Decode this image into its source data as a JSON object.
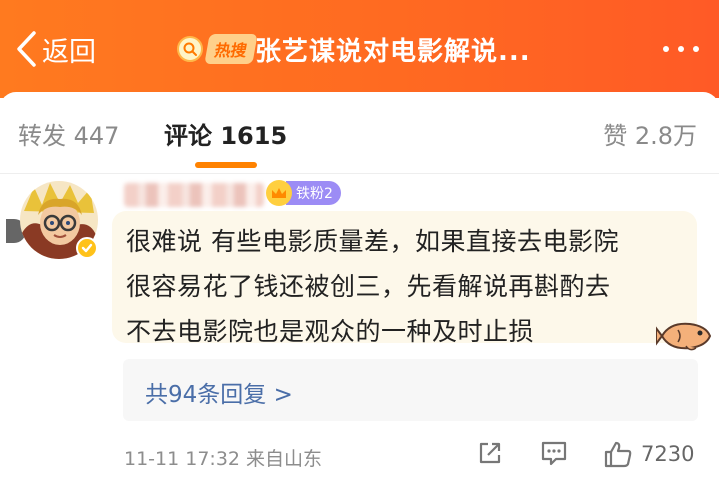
{
  "header": {
    "back_label": "返回",
    "hot_label": "热搜",
    "title": "张艺谋说对电影解说..."
  },
  "tabs": {
    "repost": "转发 447",
    "comment": "评论 1615",
    "like": "赞 2.8万",
    "active": "comment"
  },
  "comment": {
    "fan_badge": "铁粉2",
    "lines": [
      "很难说 有些电影质量差，如果直接去电影院",
      "很容易花了钱还被创三，先看解说再斟酌去",
      "不去电影院也是观众的一种及时止损"
    ],
    "replies_label": "共94条回复 >",
    "meta": "11-11 17:32  来自山东",
    "like_count": "7230"
  },
  "colors": {
    "header_orange": "#ff6a21",
    "tab_indicator": "#ff8200",
    "reply_link": "#4a6ea8",
    "bubble_bg": "#fdf8ea"
  },
  "icons": [
    "back-chevron-icon",
    "hot-search-icon",
    "more-icon",
    "verified-icon",
    "crown-icon",
    "fish-sticker-icon",
    "share-icon",
    "comment-icon",
    "thumbs-up-icon"
  ]
}
